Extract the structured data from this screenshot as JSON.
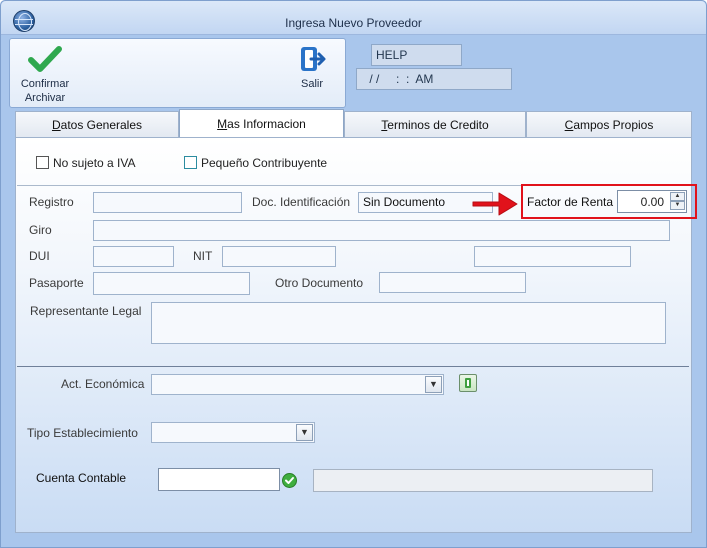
{
  "window": {
    "title": "Ingresa Nuevo Proveedor"
  },
  "toolbar": {
    "confirm_line1": "Confirmar",
    "confirm_line2": "Archivar",
    "exit_label": "Salir",
    "help_text": "HELP",
    "date_text": " / /     :  :  AM"
  },
  "tabs": [
    {
      "label_u": "D",
      "label_rest": "atos Generales",
      "active": false
    },
    {
      "label_u": "M",
      "label_rest": "as Informacion",
      "active": true
    },
    {
      "label_u": "T",
      "label_rest": "erminos de Credito",
      "active": false
    },
    {
      "label_u": "C",
      "label_rest": "ampos Propios",
      "active": false
    }
  ],
  "form": {
    "no_sujeto_iva": {
      "label": "No sujeto a IVA",
      "checked": false
    },
    "pequeno_contribuyente": {
      "label": "Pequeño Contribuyente",
      "checked": false
    },
    "registro_label": "Registro",
    "doc_ident_label": "Doc. Identificación",
    "doc_ident_value": "Sin Documento",
    "factor_renta_label": "Factor de Renta",
    "factor_renta_value": "0.00",
    "giro_label": "Giro",
    "dui_label": "DUI",
    "nit_label": "NIT",
    "pasaporte_label": "Pasaporte",
    "otro_doc_label": "Otro Documento",
    "representante_label": "Representante Legal",
    "act_economica_label": "Act. Económica",
    "tipo_establecimiento_label": "Tipo Establecimiento",
    "cuenta_contable_label": "Cuenta Contable"
  },
  "colors": {
    "highlight": "#e1121b",
    "confirm_green": "#2fa84f",
    "exit_blue": "#2a73c8"
  }
}
